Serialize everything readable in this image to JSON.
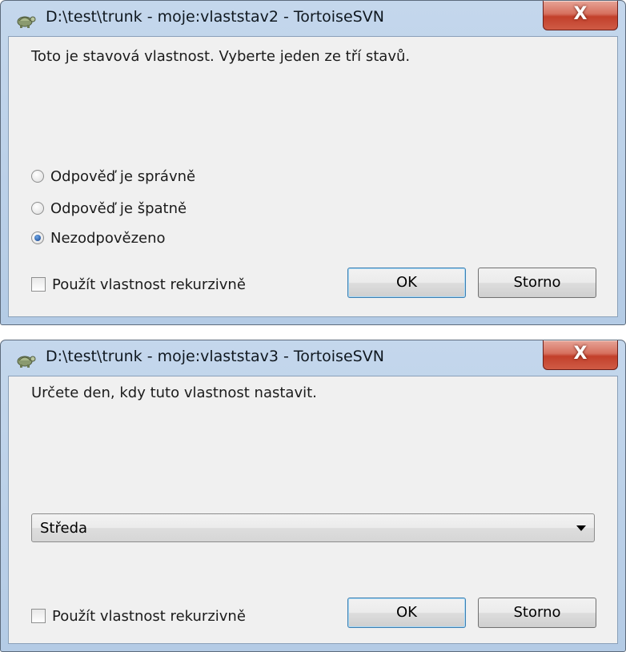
{
  "dialogs": [
    {
      "title": "D:\\test\\trunk - moje:vlaststav2 - TortoiseSVN",
      "close_label": "X",
      "message": "Toto je stavová vlastnost. Vyberte jeden ze tří stavů.",
      "options": [
        {
          "label": "Odpověď je správně",
          "selected": false
        },
        {
          "label": "Odpověď je špatně",
          "selected": false
        },
        {
          "label": "Nezodpovězeno",
          "selected": true
        }
      ],
      "recursive_label": "Použít vlastnost rekurzivně",
      "recursive_checked": false,
      "ok_label": "OK",
      "cancel_label": "Storno"
    },
    {
      "title": "D:\\test\\trunk - moje:vlaststav3 - TortoiseSVN",
      "close_label": "X",
      "message": "Určete den, kdy tuto vlastnost nastavit.",
      "select_value": "Středa",
      "recursive_label": "Použít vlastnost rekurzivně",
      "recursive_checked": false,
      "ok_label": "OK",
      "cancel_label": "Storno"
    }
  ],
  "icons": {
    "app": "tortoisesvn-turtle-icon",
    "close": "close-icon",
    "dropdown": "chevron-down-icon"
  },
  "colors": {
    "titlebar": "#c4d7ec",
    "client": "#f0f0f0",
    "close_button": "#c2402b",
    "default_button_border": "#3c7fb1"
  }
}
